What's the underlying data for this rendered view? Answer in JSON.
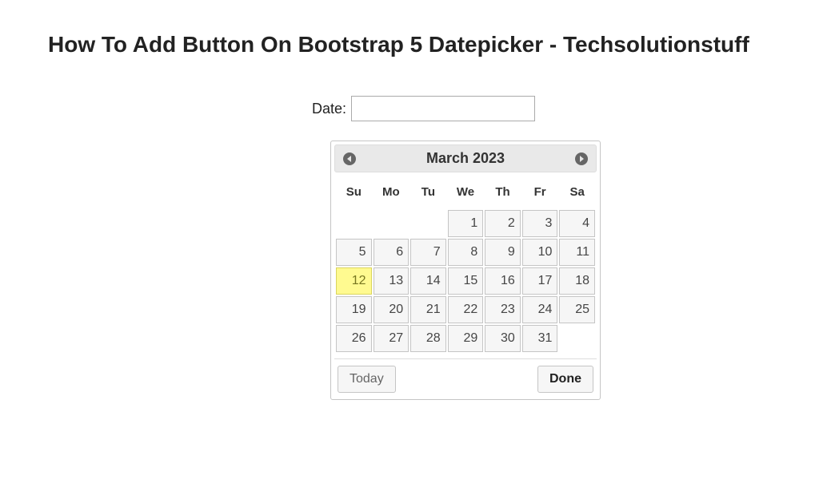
{
  "heading": "How To Add Button On Bootstrap 5 Datepicker - Techsolutionstuff",
  "form": {
    "label": "Date:",
    "value": ""
  },
  "datepicker": {
    "title": "March 2023",
    "day_headers": [
      "Su",
      "Mo",
      "Tu",
      "We",
      "Th",
      "Fr",
      "Sa"
    ],
    "weeks": [
      [
        null,
        null,
        null,
        1,
        2,
        3,
        4
      ],
      [
        5,
        6,
        7,
        8,
        9,
        10,
        11
      ],
      [
        12,
        13,
        14,
        15,
        16,
        17,
        18
      ],
      [
        19,
        20,
        21,
        22,
        23,
        24,
        25
      ],
      [
        26,
        27,
        28,
        29,
        30,
        31,
        null
      ]
    ],
    "highlighted_day": 12,
    "today_label": "Today",
    "done_label": "Done"
  }
}
